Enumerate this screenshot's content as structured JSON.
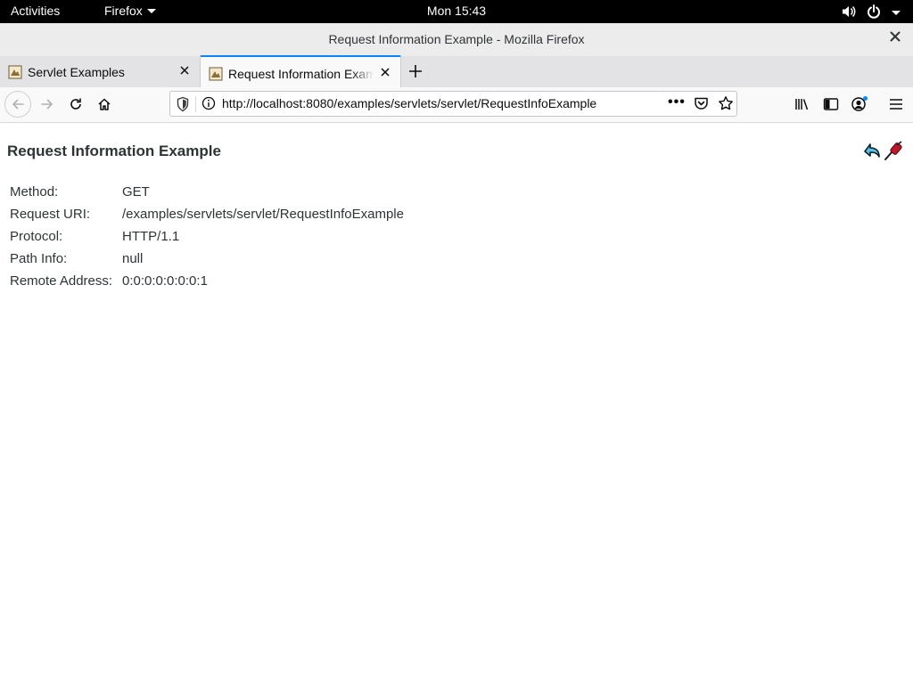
{
  "system_bar": {
    "activities": "Activities",
    "app_menu": "Firefox",
    "clock": "Mon 15:43"
  },
  "window": {
    "title": "Request Information Example - Mozilla Firefox"
  },
  "tabs": [
    {
      "label": "Servlet Examples",
      "active": false
    },
    {
      "label": "Request Information Example",
      "active": true
    }
  ],
  "navbar": {
    "url": "http://localhost:8080/examples/servlets/servlet/RequestInfoExample",
    "more_label": "•••"
  },
  "page": {
    "heading": "Request Information Example",
    "rows": [
      {
        "key": "Method:",
        "value": "GET"
      },
      {
        "key": "Request URI:",
        "value": "/examples/servlets/servlet/RequestInfoExample"
      },
      {
        "key": "Protocol:",
        "value": "HTTP/1.1"
      },
      {
        "key": "Path Info:",
        "value": "null"
      },
      {
        "key": "Remote Address:",
        "value": "0:0:0:0:0:0:0:1"
      }
    ]
  },
  "colors": {
    "system_bar": "#000000",
    "titlebar": "#ececec",
    "tabstrip": "#e3e3e5",
    "active_tab_accent": "#0a84ff",
    "text": "#2e3436"
  },
  "icons": [
    "caret-down-icon",
    "volume-icon",
    "power-icon",
    "close-icon",
    "favicon-icon",
    "tab-close-icon",
    "plus-icon",
    "back-arrow-icon",
    "forward-arrow-icon",
    "reload-icon",
    "home-icon",
    "shield-icon",
    "info-icon",
    "page-actions-icon",
    "pocket-icon",
    "star-icon",
    "library-icon",
    "sidebar-icon",
    "account-icon",
    "hamburger-menu-icon",
    "return-icon",
    "execute-icon"
  ]
}
